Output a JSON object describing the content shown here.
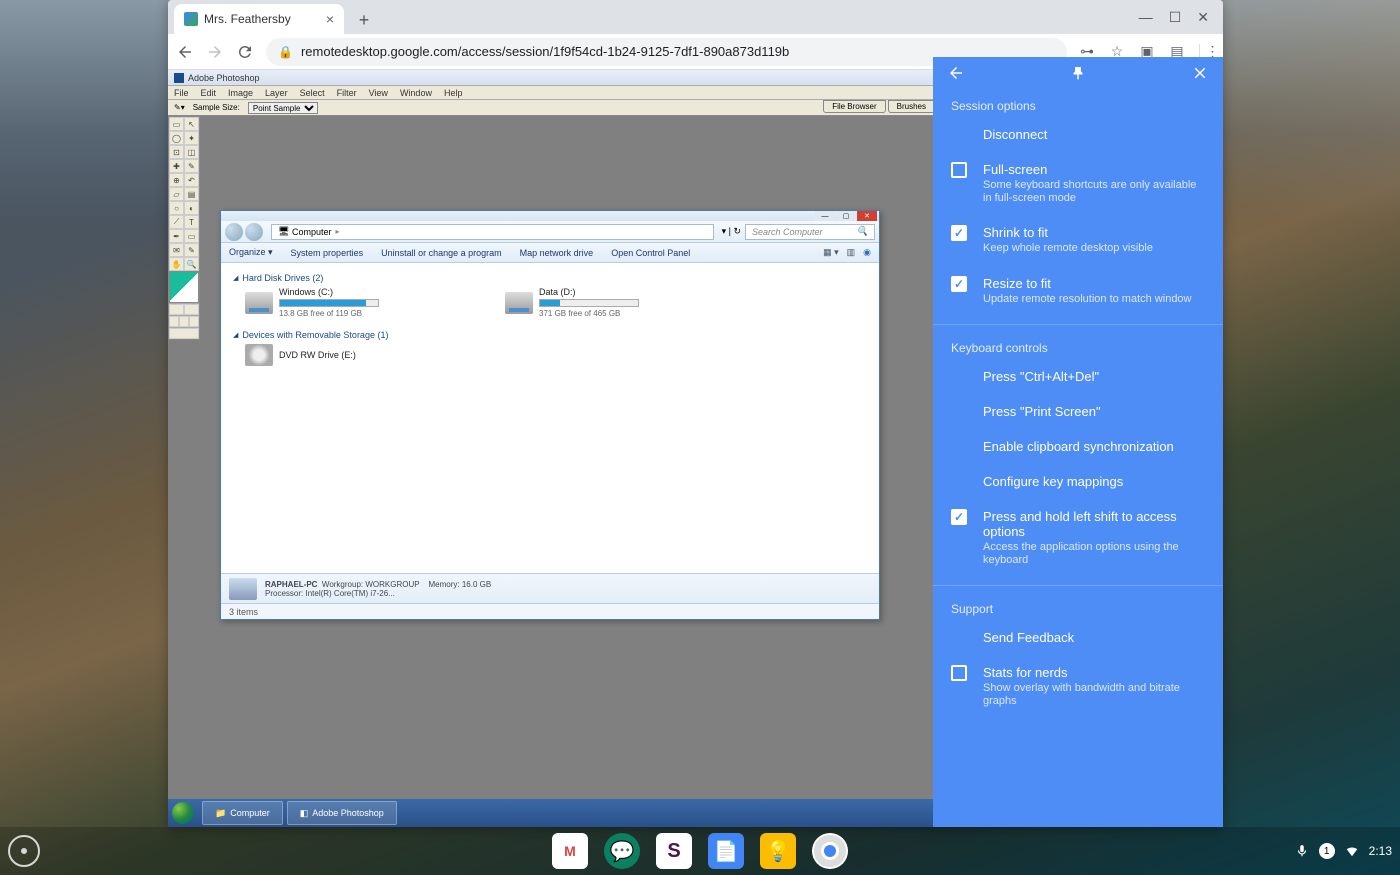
{
  "browser": {
    "tab_title": "Mrs. Feathersby",
    "url": "remotedesktop.google.com/access/session/1f9f54cd-1b24-9125-7df1-890a873d119b"
  },
  "photoshop": {
    "title": "Adobe Photoshop",
    "menu": [
      "File",
      "Edit",
      "Image",
      "Layer",
      "Select",
      "Filter",
      "View",
      "Window",
      "Help"
    ],
    "option_label": "Sample Size:",
    "option_value": "Point Sample",
    "tabs": [
      "File Browser",
      "Brushes"
    ]
  },
  "explorer": {
    "path_icon": "🖥",
    "path": "Computer",
    "search_placeholder": "Search Computer",
    "cmds": [
      "Organize ▾",
      "System properties",
      "Uninstall or change a program",
      "Map network drive",
      "Open Control Panel"
    ],
    "group1": "Hard Disk Drives (2)",
    "drives": [
      {
        "name": "Windows (C:)",
        "free": "13.8 GB free of 119 GB",
        "fill": 88
      },
      {
        "name": "Data (D:)",
        "free": "371 GB free of 465 GB",
        "fill": 20
      }
    ],
    "group2": "Devices with Removable Storage (1)",
    "dvd": "DVD RW Drive (E:)",
    "details": {
      "name": "RAPHAEL-PC",
      "workgroup_lbl": "Workgroup:",
      "workgroup": "WORKGROUP",
      "proc_lbl": "Processor:",
      "proc": "Intel(R) Core(TM) i7-26...",
      "mem_lbl": "Memory:",
      "mem": "16.0 GB"
    },
    "status": "3 items"
  },
  "taskbar": {
    "items": [
      "Computer",
      "Adobe Photoshop"
    ]
  },
  "panel": {
    "section1": "Session options",
    "disconnect": "Disconnect",
    "fullscreen": {
      "title": "Full-screen",
      "sub": "Some keyboard shortcuts are only available in full-screen mode",
      "checked": false
    },
    "shrink": {
      "title": "Shrink to fit",
      "sub": "Keep whole remote desktop visible",
      "checked": true
    },
    "resize": {
      "title": "Resize to fit",
      "sub": "Update remote resolution to match window",
      "checked": true
    },
    "section2": "Keyboard controls",
    "ctrlaltdel": "Press \"Ctrl+Alt+Del\"",
    "printscreen": "Press \"Print Screen\"",
    "clipboard": "Enable clipboard synchronization",
    "keymap": "Configure key mappings",
    "shift": {
      "title": "Press and hold left shift to access options",
      "sub": "Access the application options using the keyboard",
      "checked": true
    },
    "section3": "Support",
    "feedback": "Send Feedback",
    "stats": {
      "title": "Stats for nerds",
      "sub": "Show overlay with bandwidth and bitrate graphs",
      "checked": false
    }
  },
  "shelf": {
    "time": "2:13",
    "notif": "1"
  }
}
